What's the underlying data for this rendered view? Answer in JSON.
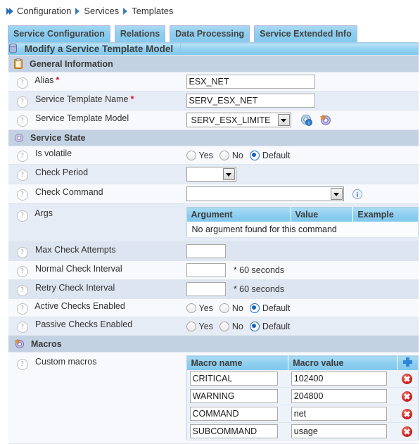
{
  "breadcrumb": {
    "items": [
      "Configuration",
      "Services",
      "Templates"
    ],
    "lead_icon": "double-chevron-icon",
    "separator_icon": "chevron-right-icon"
  },
  "tabs": [
    {
      "label": "Service Configuration",
      "active": true
    },
    {
      "label": "Relations",
      "active": false
    },
    {
      "label": "Data Processing",
      "active": false
    },
    {
      "label": "Service Extended Info",
      "active": false
    }
  ],
  "panel": {
    "title": "Modify a Service Template Model",
    "title_icon": "database-icon"
  },
  "sections": {
    "general": {
      "title": "General Information",
      "icon": "clipboard-icon",
      "alias": {
        "label": "Alias",
        "required": true,
        "value": "ESX_NET"
      },
      "template_name": {
        "label": "Service Template Name",
        "required": true,
        "value": "SERV_ESX_NET"
      },
      "template_model": {
        "label": "Service Template Model",
        "value": "SERV_ESX_LIMITE",
        "icons": [
          "info-gear-icon",
          "macro-gear-icon"
        ]
      }
    },
    "service_state": {
      "title": "Service State",
      "icon": "gear-icon",
      "is_volatile": {
        "label": "Is volatile",
        "options": [
          "Yes",
          "No",
          "Default"
        ],
        "selected": "Default"
      },
      "check_period": {
        "label": "Check Period",
        "value": ""
      },
      "check_command": {
        "label": "Check Command",
        "value": "",
        "icon": "info-icon"
      },
      "args": {
        "label": "Args",
        "columns": [
          "Argument",
          "Value",
          "Example"
        ],
        "empty_message": "No argument found for this command",
        "rows": []
      },
      "max_check_attempts": {
        "label": "Max Check Attempts",
        "value": ""
      },
      "normal_check_interval": {
        "label": "Normal Check Interval",
        "value": "",
        "suffix": "* 60 seconds"
      },
      "retry_check_interval": {
        "label": "Retry Check Interval",
        "value": "",
        "suffix": "* 60 seconds"
      },
      "active_checks": {
        "label": "Active Checks Enabled",
        "options": [
          "Yes",
          "No",
          "Default"
        ],
        "selected": "Default"
      },
      "passive_checks": {
        "label": "Passive Checks Enabled",
        "options": [
          "Yes",
          "No",
          "Default"
        ],
        "selected": "Default"
      }
    },
    "macros": {
      "title": "Macros",
      "icon": "macro-gear-icon",
      "custom_macros": {
        "label": "Custom macros",
        "columns": [
          "Macro name",
          "Macro value"
        ],
        "add_icon": "plus-icon",
        "delete_icon": "delete-icon",
        "rows": [
          {
            "name": "CRITICAL",
            "value": "102400",
            "focused": false
          },
          {
            "name": "WARNING",
            "value": "204800",
            "focused": true
          },
          {
            "name": "COMMAND",
            "value": "net",
            "focused": false
          },
          {
            "name": "SUBCOMMAND",
            "value": "usage",
            "focused": false
          }
        ]
      }
    }
  },
  "colors": {
    "tab_blue": "#8dcdef",
    "title_blue": "#95d2f0",
    "section_gray": "#c3d2e3",
    "required_red": "#d8132a",
    "accent_blue": "#2f86d8",
    "delete_red": "#c5191b"
  }
}
